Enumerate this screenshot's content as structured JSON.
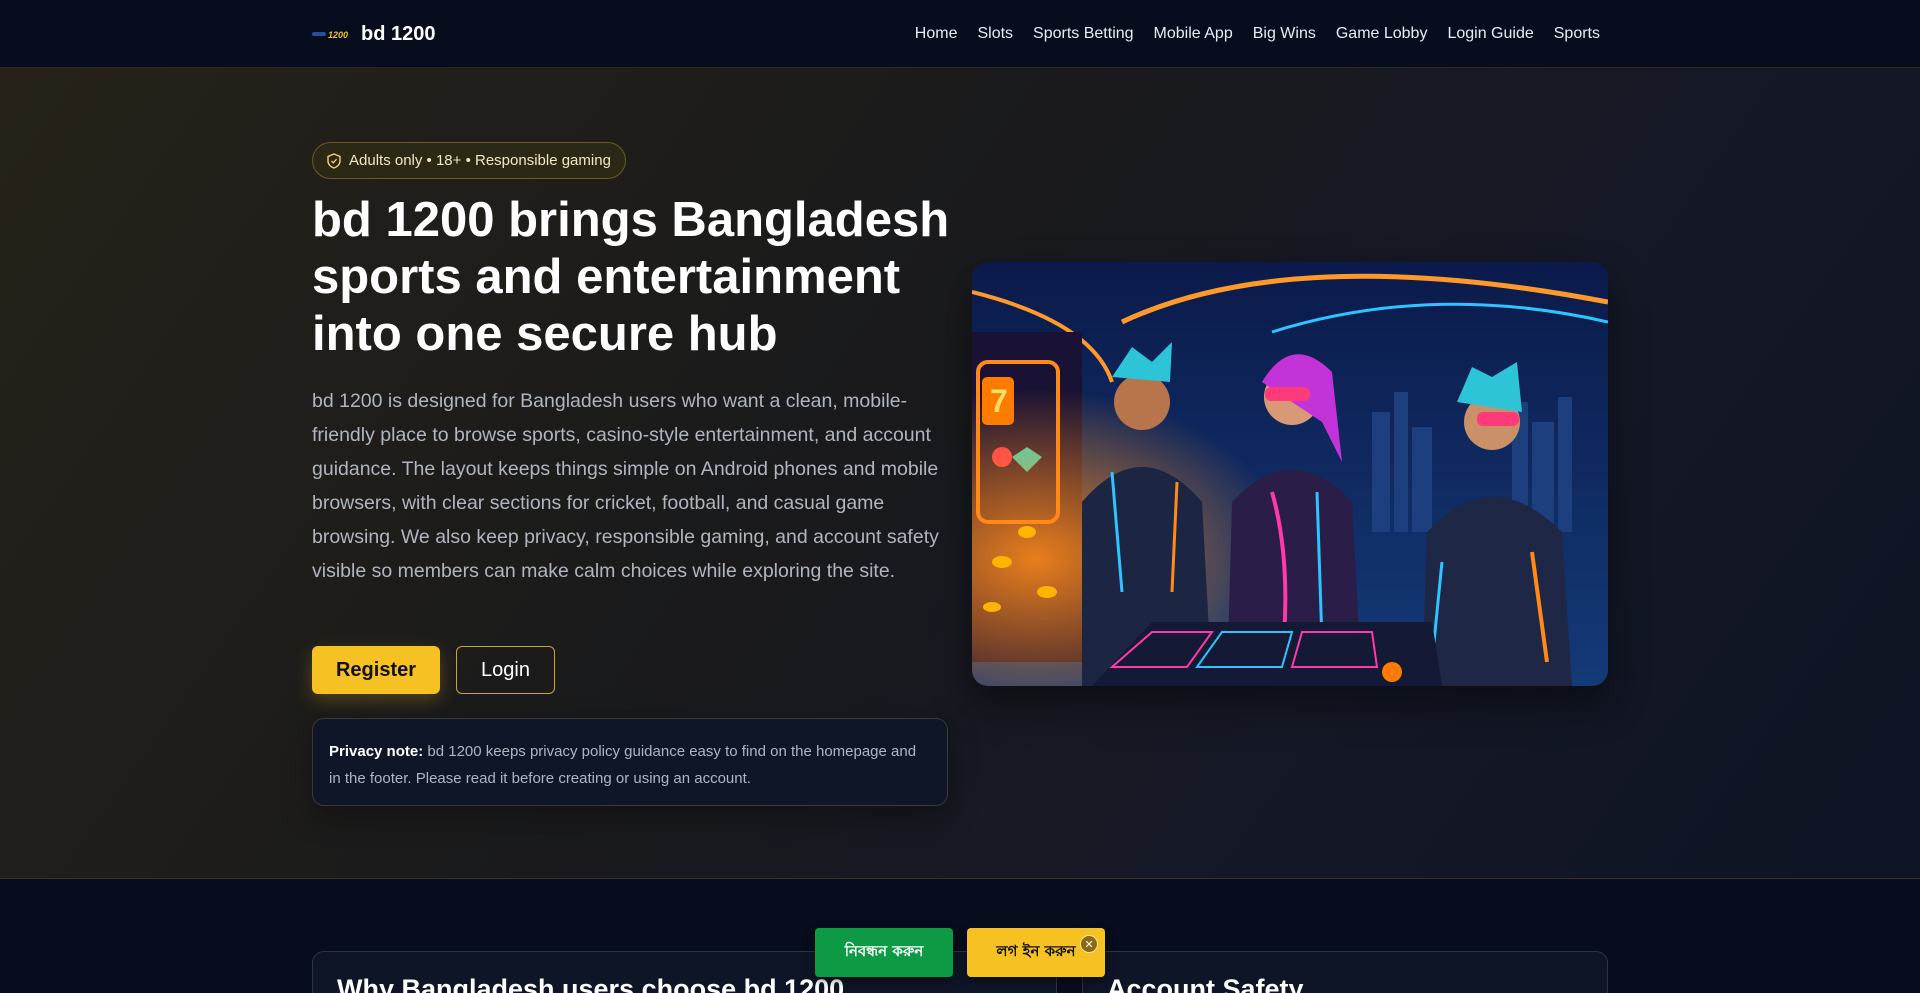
{
  "header": {
    "logo_text": "1200",
    "brand_name": "bd 1200",
    "nav": [
      "Home",
      "Slots",
      "Sports Betting",
      "Mobile App",
      "Big Wins",
      "Game Lobby",
      "Login Guide",
      "Sports"
    ]
  },
  "hero": {
    "badge": "Adults only • 18+ • Responsible gaming",
    "title": "bd 1200 brings Bangladesh sports and entertainment into one secure hub",
    "description": "bd 1200 is designed for Bangladesh users who want a clean, mobile-friendly place to browse sports, casino-style entertainment, and account guidance. The layout keeps things simple on Android phones and mobile browsers, with clear sections for cricket, football, and casual game browsing. We also keep privacy, responsible gaming, and account safety visible so members can make calm choices while exploring the site.",
    "register_label": "Register",
    "login_label": "Login",
    "privacy_label": "Privacy note:",
    "privacy_text": " bd 1200 keeps privacy policy guidance easy to find on the homepage and in the footer. Please read it before creating or using an account."
  },
  "section": {
    "left_card_title": "Why Bangladesh users choose bd 1200",
    "right_card_title": "Account Safety"
  },
  "floating": {
    "register_label": "নিবন্ধন করুন",
    "login_label": "লগ ইন করুন",
    "close_label": "✕"
  },
  "colors": {
    "accent": "#f6c123",
    "green": "#0e9a45",
    "background": "#070d1d"
  },
  "icons": {
    "badge": "shield-icon",
    "close": "close-icon"
  }
}
